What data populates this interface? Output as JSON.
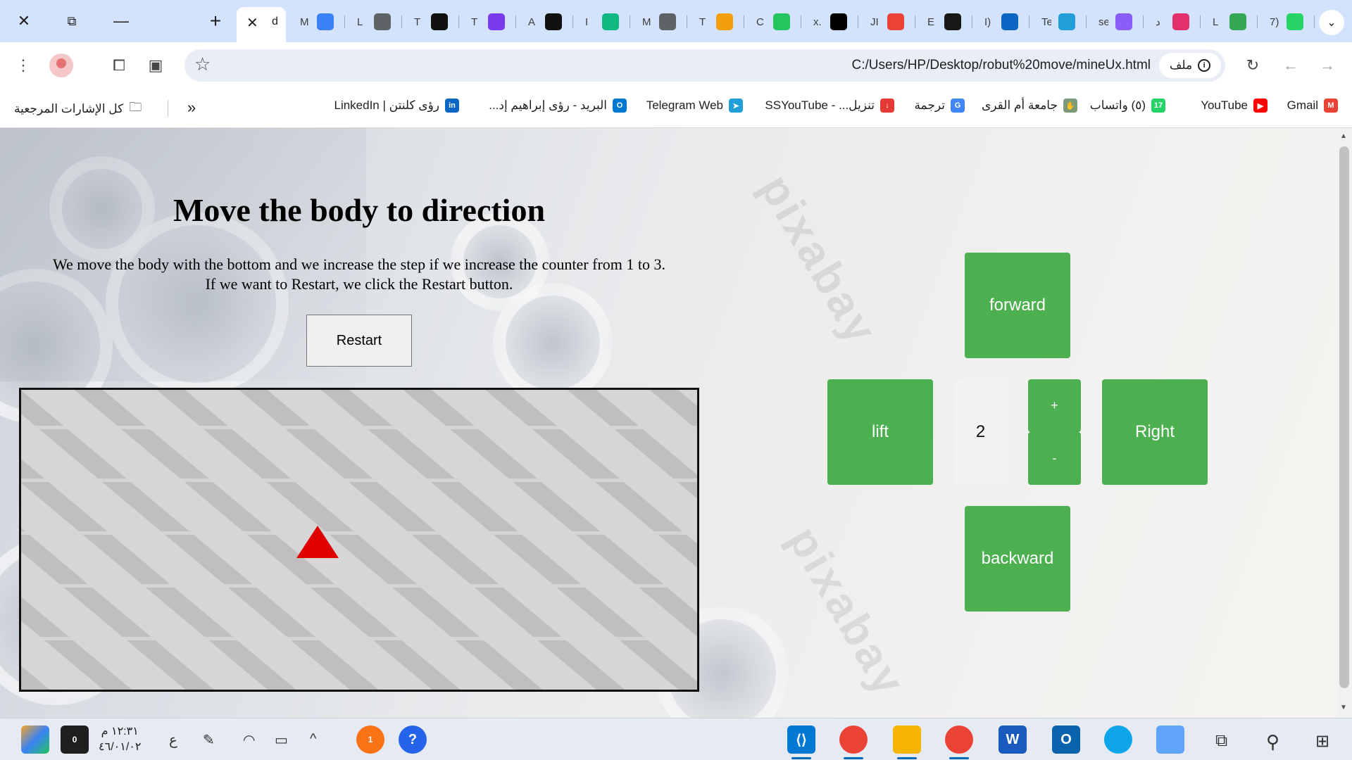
{
  "browser": {
    "active_tab_title": "d",
    "tab_letters": [
      "M",
      "L",
      "T",
      "T",
      "A",
      "I",
      "M",
      "T",
      "C",
      "x.",
      "JI",
      "E",
      "I)",
      "Te",
      "se",
      "د",
      "L",
      "7)"
    ],
    "tab_favicon_colors": [
      "#3b82f6",
      "#5f6368",
      "#111111",
      "#7c3aed",
      "#111111",
      "#10b981",
      "#5f6368",
      "#f59e0b",
      "#22c55e",
      "#000000",
      "#ea4335",
      "#181717",
      "#0a66c2",
      "#229ed9",
      "#8b5cf6",
      "#e1306c",
      "#34a853",
      "#25d366"
    ],
    "new_tab_symbol": "+",
    "url": "C:/Users/HP/Desktop/robut%20move/mineUx.html",
    "site_chip_label": "ملف",
    "bookmarks": [
      {
        "label": "Gmail",
        "icon": "gmail-icon",
        "color": "#ea4335",
        "glyph": "M"
      },
      {
        "label": "YouTube",
        "icon": "youtube-icon",
        "color": "#ff0000",
        "glyph": "▶"
      },
      {
        "label": "(٥) واتساب",
        "icon": "whatsapp-icon",
        "color": "#25d366",
        "glyph": "17"
      },
      {
        "label": "جامعة أم القرى",
        "icon": "university-icon",
        "color": "#7a9a7a",
        "glyph": "✋"
      },
      {
        "label": "ترجمة",
        "icon": "translate-icon",
        "color": "#4285f4",
        "glyph": "G"
      },
      {
        "label": "تنزيل... - SSYouTube",
        "icon": "ssyoutube-icon",
        "color": "#e53935",
        "glyph": "↓"
      },
      {
        "label": "Telegram Web",
        "icon": "telegram-icon",
        "color": "#229ed9",
        "glyph": "➤"
      },
      {
        "label": "البريد - رؤى إبراهيم إد...",
        "icon": "outlook-icon",
        "color": "#0078d4",
        "glyph": "O"
      },
      {
        "label": "رؤى كلنتن | LinkedIn",
        "icon": "linkedin-icon",
        "color": "#0a66c2",
        "glyph": "in"
      }
    ],
    "all_bookmarks_label": "كل الإشارات المرجعية",
    "more_bookmarks": "«"
  },
  "page": {
    "title": "Move the body to direction",
    "description_line1": "We move the body with the bottom and we increase the step if we increase the counter from 1 to 3.",
    "description_line2": "If we want to Restart, we click the Restart button.",
    "restart_label": "Restart",
    "watermark_text": "pixabay",
    "controls": {
      "forward": "forward",
      "left": "lift",
      "right": "Right",
      "backward": "backward",
      "plus": "+",
      "minus": "-",
      "counter": "2"
    },
    "robot": {
      "color": "#e00000",
      "shape": "triangle-up"
    },
    "button_color": "#4caf50"
  },
  "taskbar": {
    "clock_time": "١٢:٣١ م",
    "clock_date": "٤٦/٠١/٠٢",
    "lang": "ع",
    "notification_badge": "1",
    "notes_badge": "0"
  }
}
